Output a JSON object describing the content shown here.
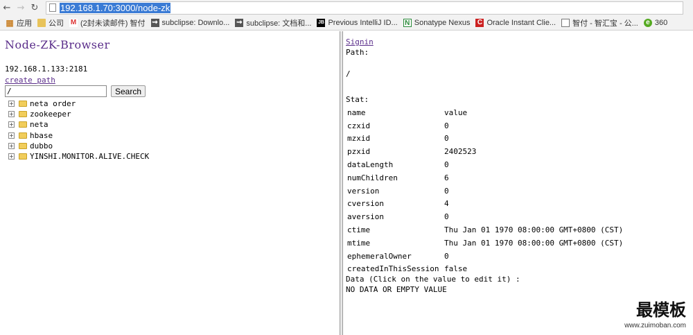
{
  "browser": {
    "url": "192.168.1.70:3000/node-zk",
    "bookmarks": [
      {
        "label": "应用",
        "icon": "apps-icon"
      },
      {
        "label": "公司",
        "icon": "folder-icon"
      },
      {
        "label": "(2封未读邮件) 智付",
        "icon": "gmail-icon"
      },
      {
        "label": "subclipse: Downlo...",
        "icon": "svn-icon"
      },
      {
        "label": "subclipse: 文档和...",
        "icon": "svn-icon"
      },
      {
        "label": "Previous IntelliJ ID...",
        "icon": "jetbrains-icon"
      },
      {
        "label": "Sonatype Nexus",
        "icon": "nexus-icon"
      },
      {
        "label": "Oracle Instant Clie...",
        "icon": "oracle-icon"
      },
      {
        "label": "智付 - 智汇宝 - 公...",
        "icon": "document-icon"
      },
      {
        "label": "360",
        "icon": "360-icon"
      }
    ]
  },
  "left": {
    "title": "Node-ZK-Browser",
    "server": "192.168.1.133:2181",
    "create_path": "create path",
    "search_value": "/",
    "search_button": "Search",
    "tree": [
      {
        "label": "neta order"
      },
      {
        "label": "zookeeper"
      },
      {
        "label": "neta"
      },
      {
        "label": "hbase"
      },
      {
        "label": "dubbo"
      },
      {
        "label": "YINSHI.MONITOR.ALIVE.CHECK"
      }
    ]
  },
  "right": {
    "signin": "Signin",
    "path_label": "Path:",
    "path_value": "/",
    "stat_label": "Stat:",
    "stat": [
      {
        "key": "name",
        "value": "value"
      },
      {
        "key": "czxid",
        "value": "0"
      },
      {
        "key": "mzxid",
        "value": "0"
      },
      {
        "key": "pzxid",
        "value": "2402523"
      },
      {
        "key": "dataLength",
        "value": "0"
      },
      {
        "key": "numChildren",
        "value": "6"
      },
      {
        "key": "version",
        "value": "0"
      },
      {
        "key": "cversion",
        "value": "4"
      },
      {
        "key": "aversion",
        "value": "0"
      },
      {
        "key": "ctime",
        "value": "Thu Jan 01 1970 08:00:00 GMT+0800 (CST)"
      },
      {
        "key": "mtime",
        "value": "Thu Jan 01 1970 08:00:00 GMT+0800 (CST)"
      },
      {
        "key": "ephemeralOwner",
        "value": "0"
      },
      {
        "key": "createdInThisSession",
        "value": "false"
      }
    ],
    "data_label": "Data (Click on the value to edit it) :",
    "data_value": "NO DATA OR EMPTY VALUE"
  },
  "watermark": {
    "brand": "最模板",
    "url": "www.zuimoban.com"
  }
}
